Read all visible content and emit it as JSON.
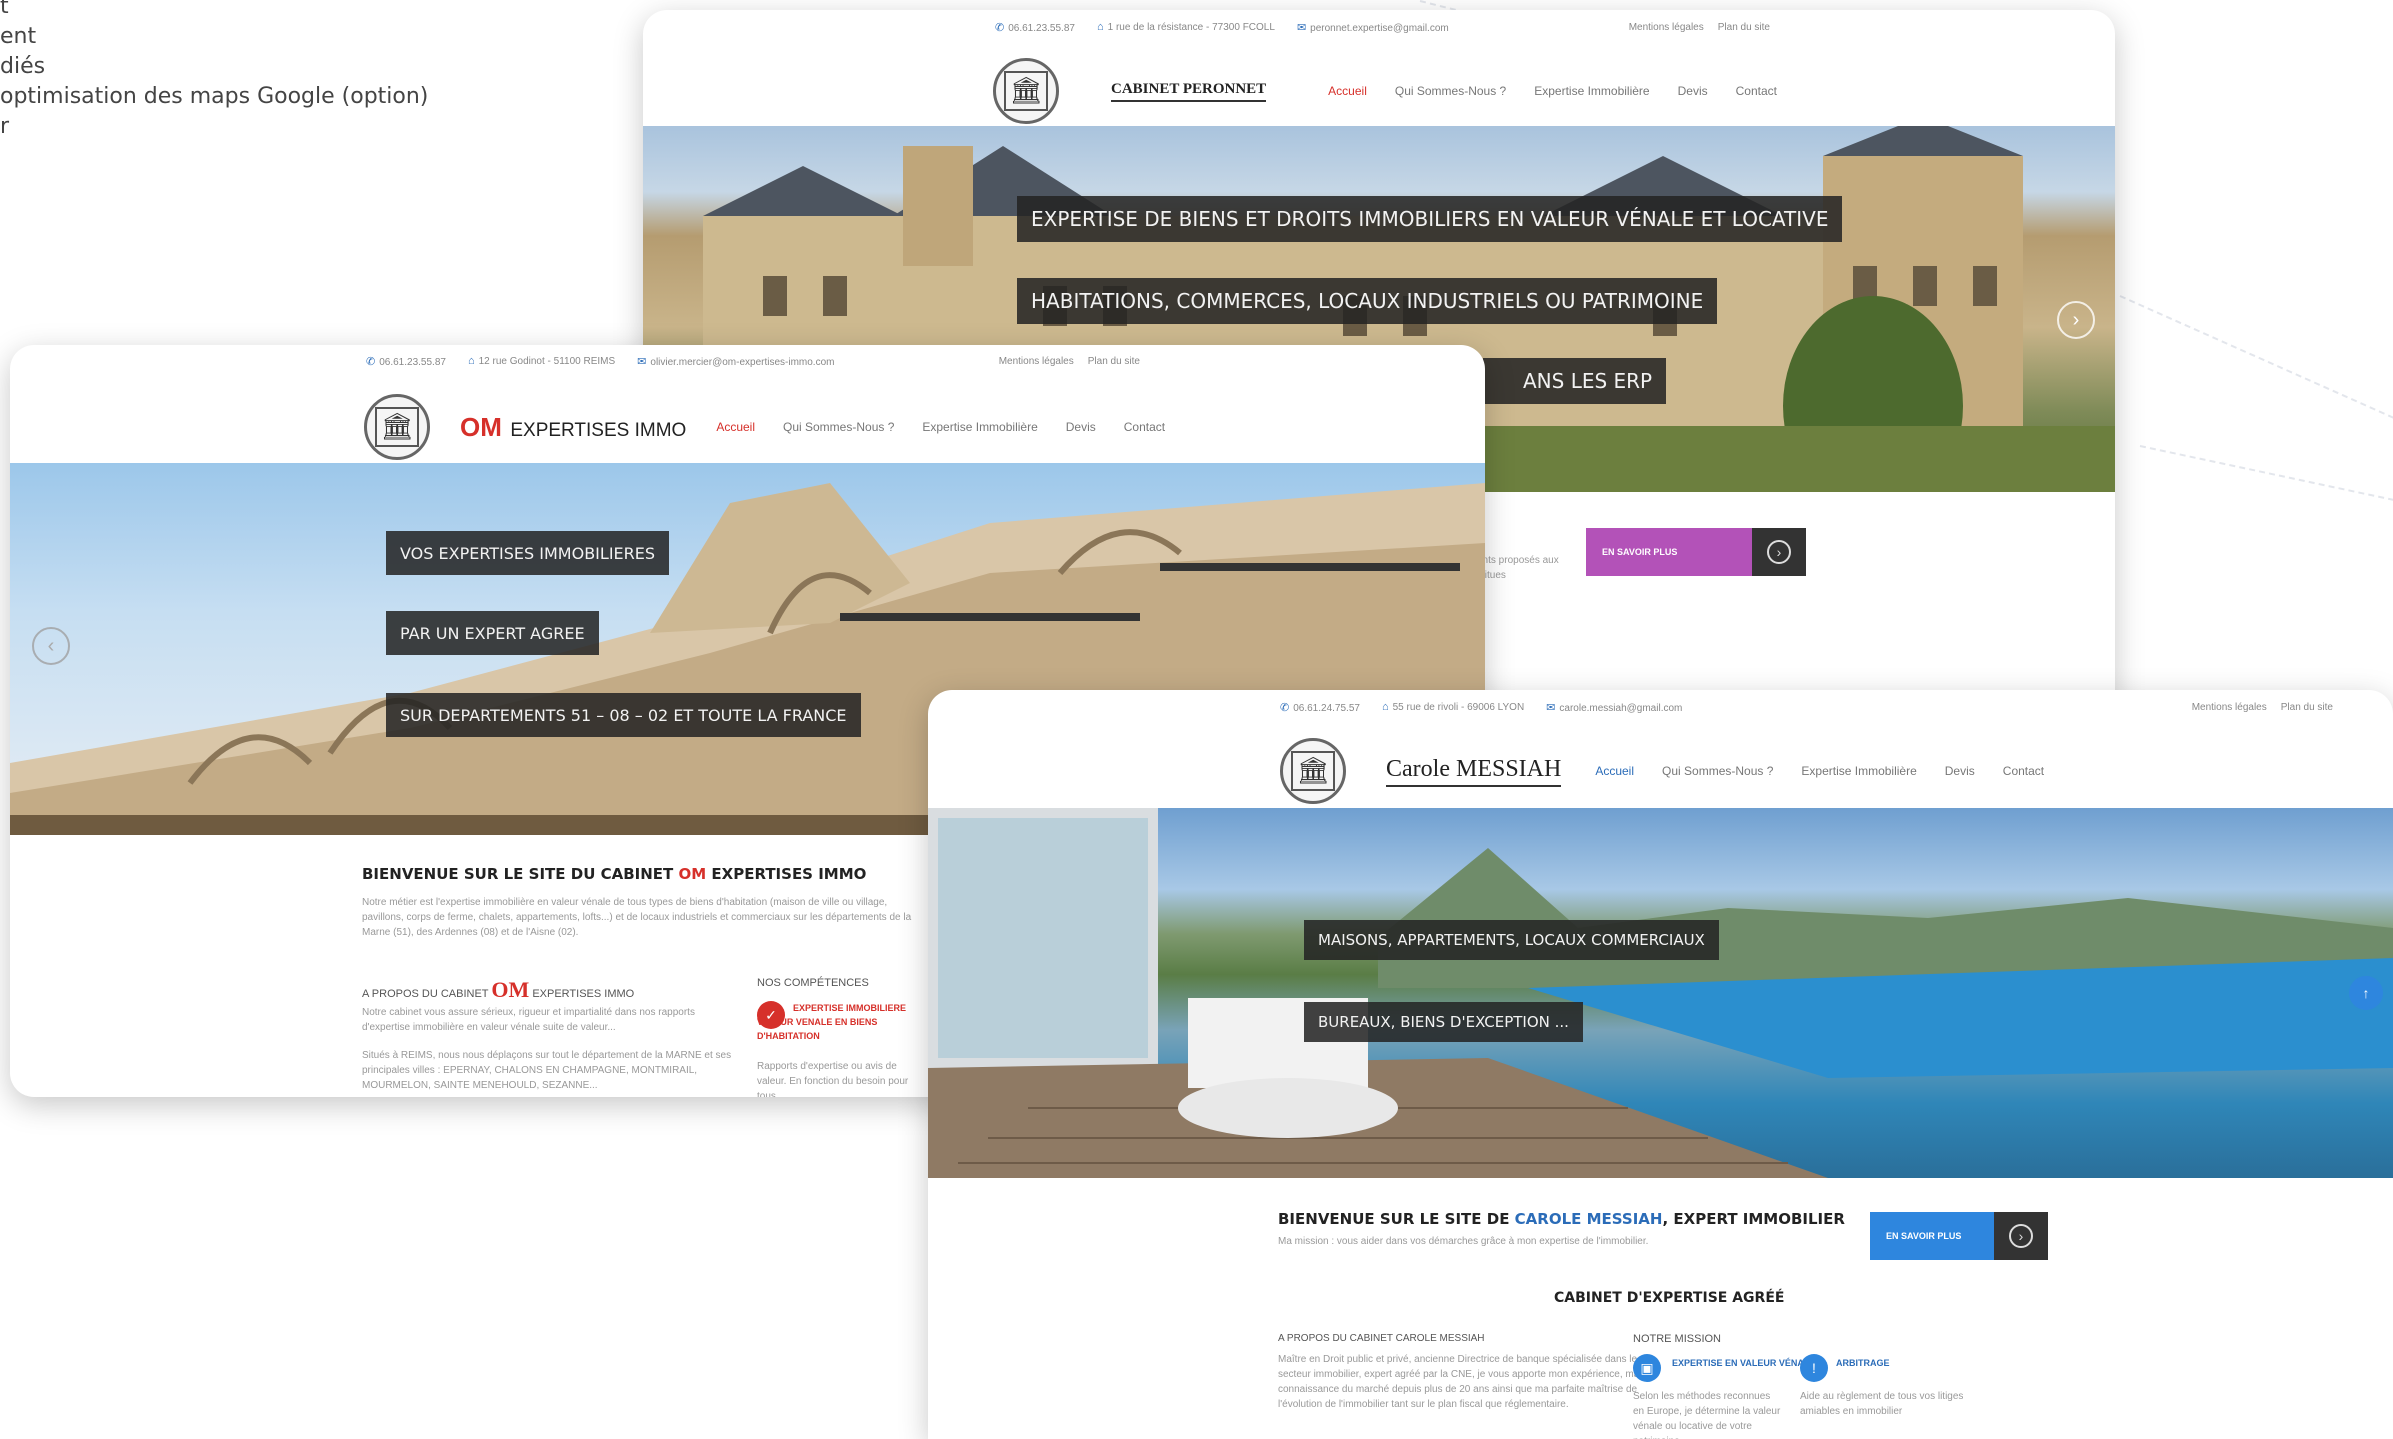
{
  "side_list": [
    "t",
    "ent",
    "diés",
    "optimisation des maps Google (option)",
    "r"
  ],
  "colors": {
    "accent_red": "#d6302a",
    "accent_blue": "#2b6cb8",
    "button_purple": "#b352b8",
    "button_blue": "#2e86de"
  },
  "peronnet": {
    "topbar": {
      "phone": "06.61.23.55.87",
      "address": "1 rue de la résistance - 77300 FCOLL",
      "email": "peronnet.expertise@gmail.com",
      "legal": "Mentions légales",
      "plan": "Plan du site"
    },
    "brand": "CABINET PERONNET",
    "nav": [
      "Accueil",
      "Qui Sommes-Nous ?",
      "Expertise Immobilière",
      "Devis",
      "Contact"
    ],
    "captions": [
      "EXPERTISE DE BIENS ET DROITS IMMOBILIERS EN VALEUR VÉNALE ET LOCATIVE",
      "HABITATIONS, COMMERCES, LOCAUX INDUSTRIELS OU PATRIMOINE",
      "ANS LES ERP"
    ],
    "intro_snippet": "ents proposés aux\nstitues",
    "more_button": "EN SAVOIR PLUS"
  },
  "om": {
    "topbar": {
      "phone": "06.61.23.55.87",
      "address": "12 rue Godinot - 51100 REIMS",
      "email": "olivier.mercier@om-expertises-immo.com",
      "legal": "Mentions légales",
      "plan": "Plan du site"
    },
    "brand_prefix": "OM",
    "brand": "EXPERTISES IMMO",
    "nav": [
      "Accueil",
      "Qui Sommes-Nous ?",
      "Expertise Immobilière",
      "Devis",
      "Contact"
    ],
    "captions": [
      "VOS EXPERTISES IMMOBILIERES",
      "PAR UN EXPERT AGREE",
      "SUR DEPARTEMENTS  51 – 08 – 02 ET TOUTE LA FRANCE"
    ],
    "welcome_prefix": "BIENVENUE SUR LE SITE DU CABINET ",
    "welcome_om": "OM",
    "welcome_suffix": " EXPERTISES IMMO",
    "welcome_text": "Notre métier est l'expertise immobilière en valeur vénale de tous types de biens d'habitation (maison de ville ou village, pavillons, corps de ferme, chalets, appartements, lofts...) et de locaux industriels et commerciaux sur les départements de la Marne (51), des Ardennes (08) et de l'Aisne (02).",
    "about_prefix": "A PROPOS DU CABINET ",
    "about_om": "OM",
    "about_suffix": " EXPERTISES IMMO",
    "about_text1": "Notre cabinet vous assure sérieux, rigueur et impartialité dans nos rapports d'expertise immobilière en valeur vénale suite de valeur...",
    "about_text2": "Situés à REIMS, nous nous déplaçons sur tout le département de la MARNE et ses principales villes : EPERNAY, CHALONS EN CHAMPAGNE, MONTMIRAIL, MOURMELON, SAINTE MENEHOULD, SEZANNE...",
    "competences_title": "NOS COMPÉTENCES",
    "competence_label": "EXPERTISE IMMOBILIERE VALEUR VENALE EN BIENS D'HABITATION",
    "competence_text": "Rapports d'expertise ou avis de valeur. En fonction du besoin pour tous"
  },
  "messiah": {
    "topbar": {
      "phone": "06.61.24.75.57",
      "address": "55 rue de rivoli - 69006 LYON",
      "email": "carole.messiah@gmail.com",
      "legal": "Mentions légales",
      "plan": "Plan du site"
    },
    "brand": "Carole MESSIAH",
    "nav": [
      "Accueil",
      "Qui Sommes-Nous ?",
      "Expertise Immobilière",
      "Devis",
      "Contact"
    ],
    "captions": [
      "MAISONS, APPARTEMENTS, LOCAUX COMMERCIAUX",
      "BUREAUX, BIENS D'EXCEPTION ..."
    ],
    "welcome_prefix": "BIENVENUE SUR LE SITE DE ",
    "welcome_name": "CAROLE MESSIAH",
    "welcome_suffix": ", EXPERT IMMOBILIER",
    "welcome_text": "Ma mission : vous aider dans vos démarches grâce à mon expertise de l'immobilier.",
    "more_button": "EN SAVOIR PLUS",
    "section_title": "CABINET D'EXPERTISE AGRÉÉ",
    "about_title": "A PROPOS DU CABINET CAROLE MESSIAH",
    "about_text": "Maître en Droit public et privé, ancienne Directrice de banque spécialisée dans le secteur immobilier, expert agréé par la CNE, je vous apporte mon expérience, ma connaissance du marché depuis plus de 20 ans ainsi que ma parfaite maîtrise de l'évolution de l'immobilier tant sur le plan fiscal que réglementaire.",
    "mission_title": "NOTRE MISSION",
    "mission1_label": "EXPERTISE EN VALEUR VÉNALE",
    "mission1_text": "Selon les méthodes reconnues en Europe, je détermine la valeur vénale ou locative de votre patrimoine",
    "mission2_label": "ARBITRAGE",
    "mission2_text": "Aide au règlement de tous vos litiges amiables en immobilier"
  }
}
